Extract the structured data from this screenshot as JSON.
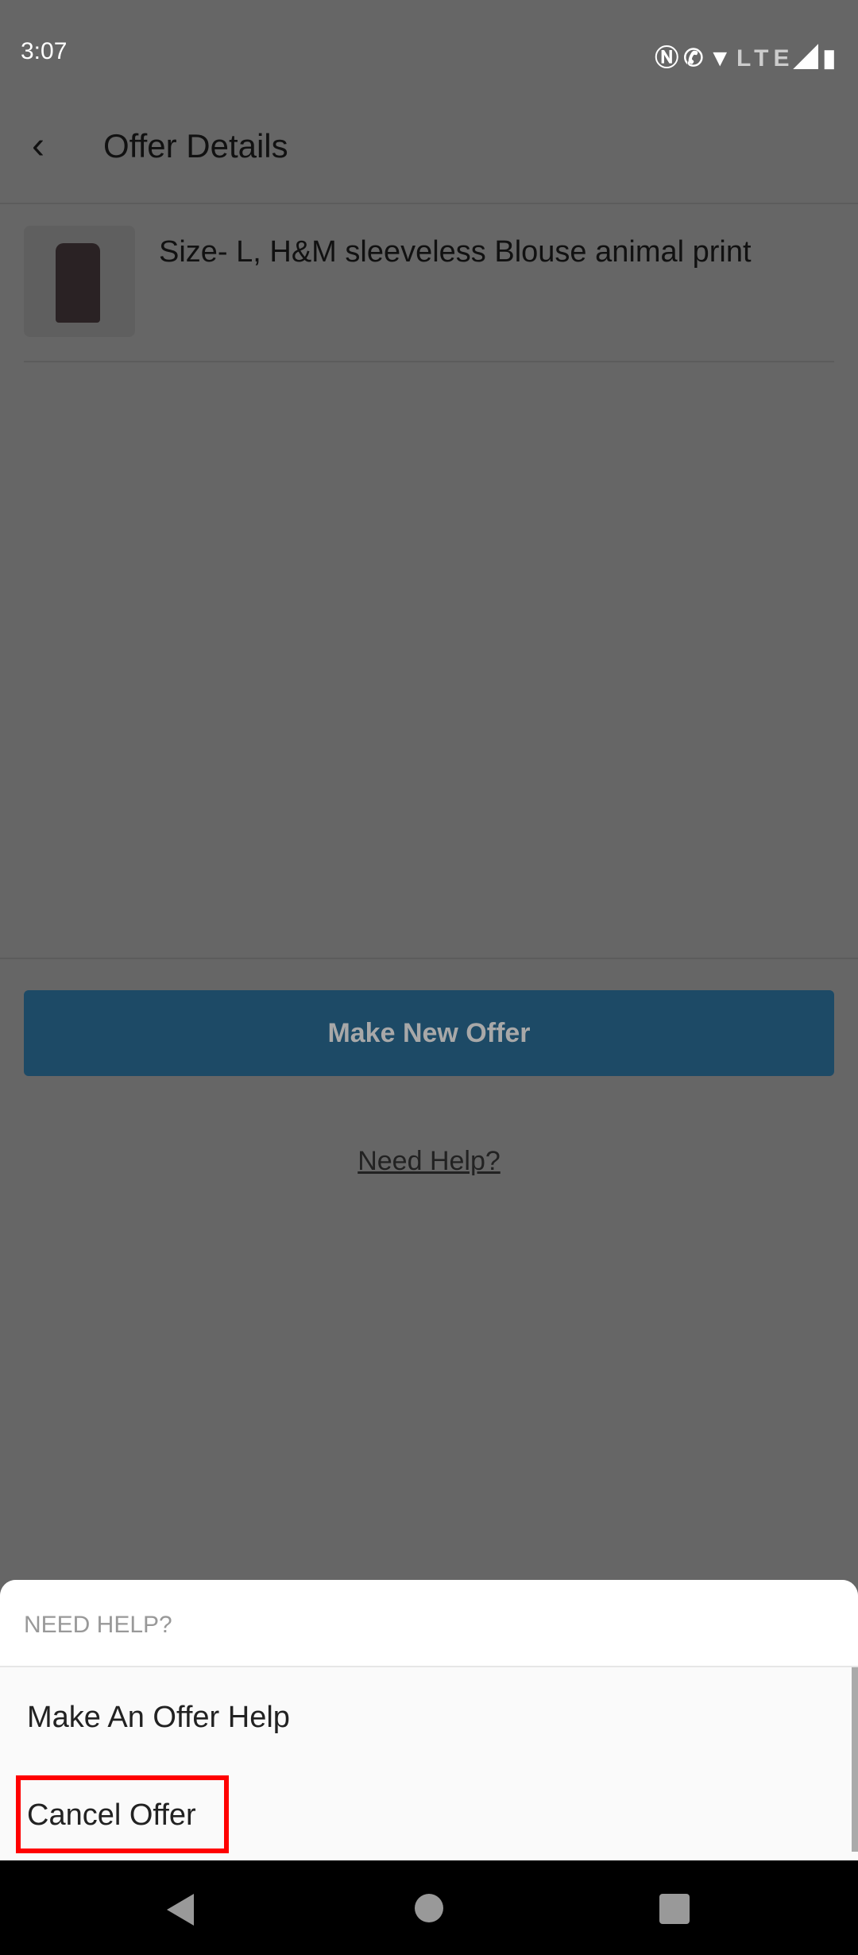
{
  "status_bar": {
    "time": "3:07",
    "icons": [
      "nfc-icon",
      "wifi-calling-icon",
      "wifi-icon",
      "lte-icon",
      "signal-icon",
      "battery-charging-icon"
    ],
    "lte_label": "LTE"
  },
  "header": {
    "title": "Offer Details",
    "back_icon": "chevron-left-icon"
  },
  "product": {
    "title": "Size- L, H&M sleeveless Blouse animal print"
  },
  "actions": {
    "make_new_offer": "Make New Offer",
    "need_help_link": "Need Help?"
  },
  "colors": {
    "primary_button": "#48b9ff",
    "highlight": "#ff0000"
  },
  "sheet": {
    "title": "NEED HELP?",
    "options": [
      {
        "label": "Make An Offer Help"
      },
      {
        "label": "Cancel Offer"
      }
    ]
  }
}
